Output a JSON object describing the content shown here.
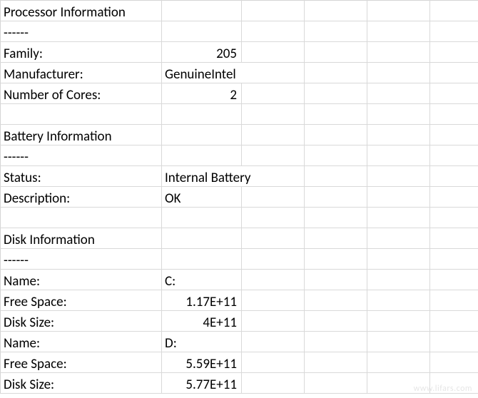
{
  "rows": [
    {
      "a": "Processor Information",
      "b": ""
    },
    {
      "a": "------",
      "b": ""
    },
    {
      "a": "Family:",
      "b": "205",
      "bnum": true
    },
    {
      "a": "Manufacturer:",
      "b": "GenuineIntel",
      "overflow": true
    },
    {
      "a": "Number of Cores:",
      "b": "2",
      "bnum": true
    },
    {
      "a": "",
      "b": ""
    },
    {
      "a": "Battery Information",
      "b": ""
    },
    {
      "a": "------",
      "b": ""
    },
    {
      "a": "Status:",
      "b": "Internal Battery",
      "overflow": true
    },
    {
      "a": "Description:",
      "b": "OK"
    },
    {
      "a": "",
      "b": ""
    },
    {
      "a": "Disk Information",
      "b": ""
    },
    {
      "a": "------",
      "b": ""
    },
    {
      "a": "Name:",
      "b": "C:"
    },
    {
      "a": "Free Space:",
      "b": "1.17E+11",
      "bnum": true
    },
    {
      "a": "Disk Size:",
      "b": "4E+11",
      "bnum": true
    },
    {
      "a": "Name:",
      "b": "D:"
    },
    {
      "a": "Free Space:",
      "b": "5.59E+11",
      "bnum": true
    },
    {
      "a": "Disk Size:",
      "b": "5.77E+11",
      "bnum": true
    }
  ],
  "watermark": "www.lifars.com"
}
